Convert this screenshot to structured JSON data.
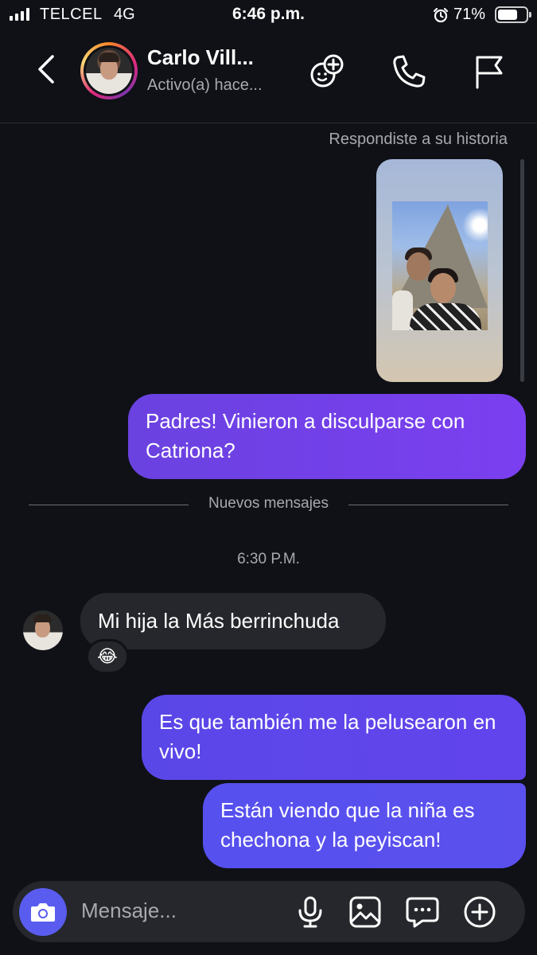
{
  "status_bar": {
    "carrier": "TELCEL",
    "network": "4G",
    "time": "6:46 p.m.",
    "battery": "71%",
    "battery_level": 0.71
  },
  "header": {
    "name": "Carlo Vill...",
    "status": "Activo(a) hace...",
    "icons": [
      "back-icon",
      "effects-icon",
      "phone-icon",
      "flag-icon"
    ]
  },
  "chat": {
    "story_label": "Respondiste a su historia",
    "messages": [
      {
        "from": "me",
        "text": "Padres! Vinieron a disculparse con Catriona?"
      },
      {
        "from": "them",
        "text": "Mi hija la Más berrinchuda",
        "reaction": "😂"
      },
      {
        "from": "me",
        "text": "Es que también me la pelusearon en vivo!"
      },
      {
        "from": "me",
        "text": "Están viendo que la niña es chechona y la peyiscan!"
      }
    ],
    "new_messages_label": "Nuevos mensajes",
    "timestamp": "6:30 P.M."
  },
  "composer": {
    "placeholder": "Mensaje...",
    "icons": [
      "camera-icon",
      "microphone-icon",
      "gallery-icon",
      "sticker-icon",
      "plus-icon"
    ]
  },
  "colors": {
    "background": "#0f1117",
    "outgoing_bubble": "#6a42e0",
    "incoming_bubble": "#26272c",
    "camera_button": "#5a5cf0"
  }
}
